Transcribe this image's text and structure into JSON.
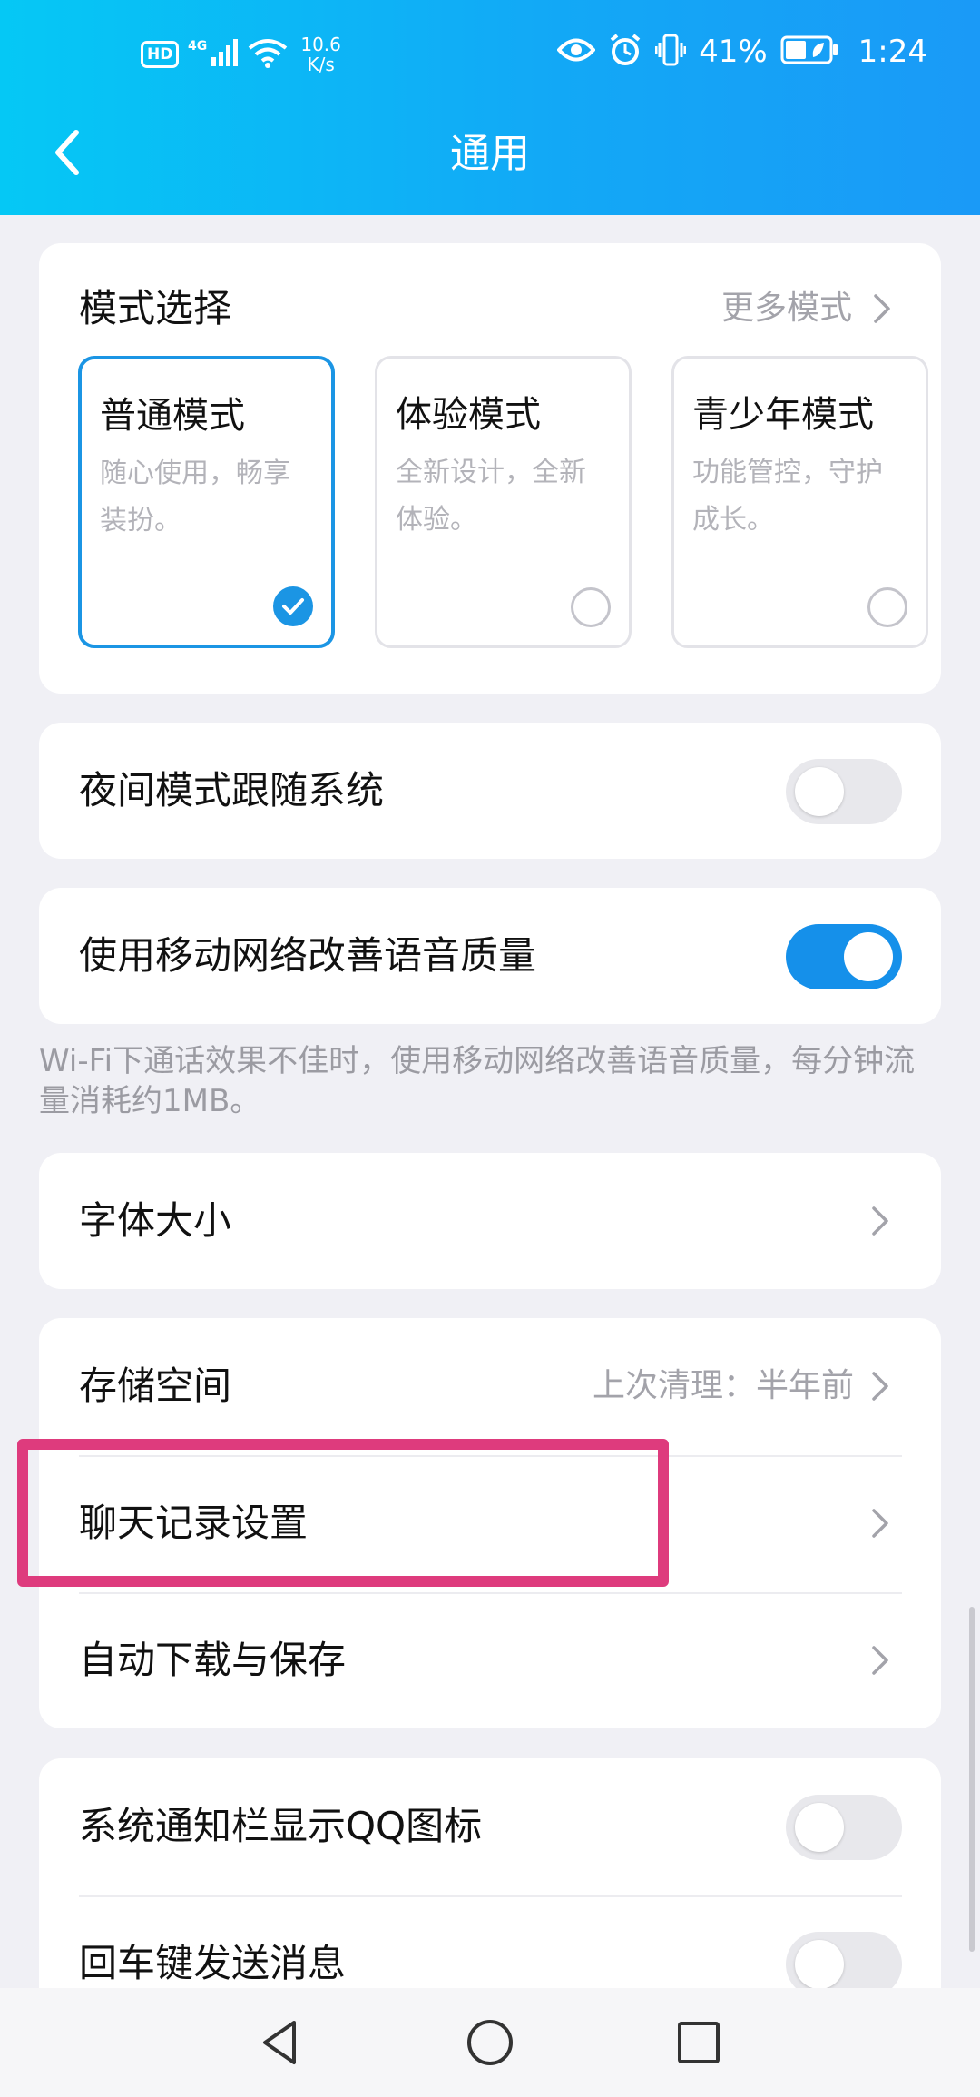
{
  "status_bar": {
    "hd": "HD",
    "network": "4G",
    "speed_value": "10.6",
    "speed_unit": "K/s",
    "battery_percent": "41%",
    "time": "1:24"
  },
  "header": {
    "title": "通用",
    "background_color": "#12a9f6"
  },
  "mode_section": {
    "title": "模式选择",
    "more_label": "更多模式",
    "options": [
      {
        "name": "普通模式",
        "desc": "随心使用，畅享装扮。",
        "selected": true
      },
      {
        "name": "体验模式",
        "desc": "全新设计，全新体验。",
        "selected": false
      },
      {
        "name": "青少年模式",
        "desc": "功能管控，守护成长。",
        "selected": false
      }
    ],
    "accent_color": "#1b95e4"
  },
  "night_mode": {
    "label": "夜间模式跟随系统",
    "enabled": false
  },
  "mobile_network_voice": {
    "label": "使用移动网络改善语音质量",
    "enabled": true
  },
  "note": "Wi-Fi下通话效果不佳时，使用移动网络改善语音质量，每分钟流量消耗约1MB。",
  "font_size": {
    "label": "字体大小"
  },
  "storage_group": {
    "storage": {
      "label": "存储空间",
      "value": "上次清理：半年前"
    },
    "chat_history": {
      "label": "聊天记录设置"
    },
    "auto_download": {
      "label": "自动下载与保存"
    }
  },
  "notification_group": {
    "show_icon": {
      "label": "系统通知栏显示QQ图标",
      "enabled": false
    },
    "enter_send": {
      "label": "回车键发送消息",
      "enabled": false
    }
  },
  "highlight_color": "#de3b7d",
  "nav": {
    "back": "back-triangle-icon",
    "home": "home-circle-icon",
    "recents": "recents-square-icon"
  }
}
